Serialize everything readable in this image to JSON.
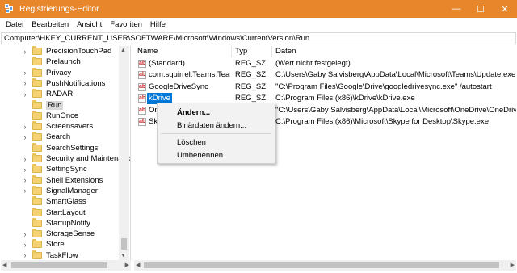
{
  "window": {
    "title": "Registrierungs-Editor"
  },
  "title_controls": [
    "—",
    "☐",
    "✕"
  ],
  "menu": [
    "Datei",
    "Bearbeiten",
    "Ansicht",
    "Favoriten",
    "Hilfe"
  ],
  "address": "Computer\\HKEY_CURRENT_USER\\SOFTWARE\\Microsoft\\Windows\\CurrentVersion\\Run",
  "tree": {
    "items": [
      {
        "label": "PrecisionTouchPad",
        "expandable": true
      },
      {
        "label": "Prelaunch",
        "expandable": false
      },
      {
        "label": "Privacy",
        "expandable": true
      },
      {
        "label": "PushNotifications",
        "expandable": true
      },
      {
        "label": "RADAR",
        "expandable": true
      },
      {
        "label": "Run",
        "expandable": false,
        "selected": true
      },
      {
        "label": "RunOnce",
        "expandable": false
      },
      {
        "label": "Screensavers",
        "expandable": true
      },
      {
        "label": "Search",
        "expandable": true
      },
      {
        "label": "SearchSettings",
        "expandable": false
      },
      {
        "label": "Security and Maintenanc",
        "expandable": true
      },
      {
        "label": "SettingSync",
        "expandable": true
      },
      {
        "label": "Shell Extensions",
        "expandable": true
      },
      {
        "label": "SignalManager",
        "expandable": true
      },
      {
        "label": "SmartGlass",
        "expandable": false
      },
      {
        "label": "StartLayout",
        "expandable": false
      },
      {
        "label": "StartupNotify",
        "expandable": false
      },
      {
        "label": "StorageSense",
        "expandable": true
      },
      {
        "label": "Store",
        "expandable": true
      },
      {
        "label": "TaskFlow",
        "expandable": true
      }
    ]
  },
  "values": {
    "columns": [
      "Name",
      "Typ",
      "Daten"
    ],
    "rows": [
      {
        "name": "(Standard)",
        "type": "REG_SZ",
        "data": "(Wert nicht festgelegt)"
      },
      {
        "name": "com.squirrel.Teams.Teams",
        "type": "REG_SZ",
        "data": "C:\\Users\\Gaby Salvisberg\\AppData\\Local\\Microsoft\\Teams\\Update.exe --processStart \"Teams.exe\""
      },
      {
        "name": "GoogleDriveSync",
        "type": "REG_SZ",
        "data": "\"C:\\Program Files\\Google\\Drive\\googledrivesync.exe\" /autostart"
      },
      {
        "name": "kDrive",
        "type": "REG_SZ",
        "data": "C:\\Program Files (x86)\\kDrive\\kDrive.exe",
        "editing": true
      },
      {
        "name": "On",
        "type": "",
        "data": "\"C:\\Users\\Gaby Salvisberg\\AppData\\Local\\Microsoft\\OneDrive\\OneDrive.exe\" /background"
      },
      {
        "name": "Sky",
        "type": "",
        "data": "C:\\Program Files (x86)\\Microsoft\\Skype for Desktop\\Skype.exe"
      }
    ]
  },
  "context_menu": {
    "items": [
      {
        "label": "Ändern...",
        "bold": true
      },
      {
        "label": "Binärdaten ändern...",
        "bold": false
      },
      {
        "label": "Löschen",
        "bold": false
      },
      {
        "label": "Umbenennen",
        "bold": false
      }
    ]
  },
  "colors": {
    "titlebar": "#e8862b",
    "selection": "#0078d7"
  }
}
